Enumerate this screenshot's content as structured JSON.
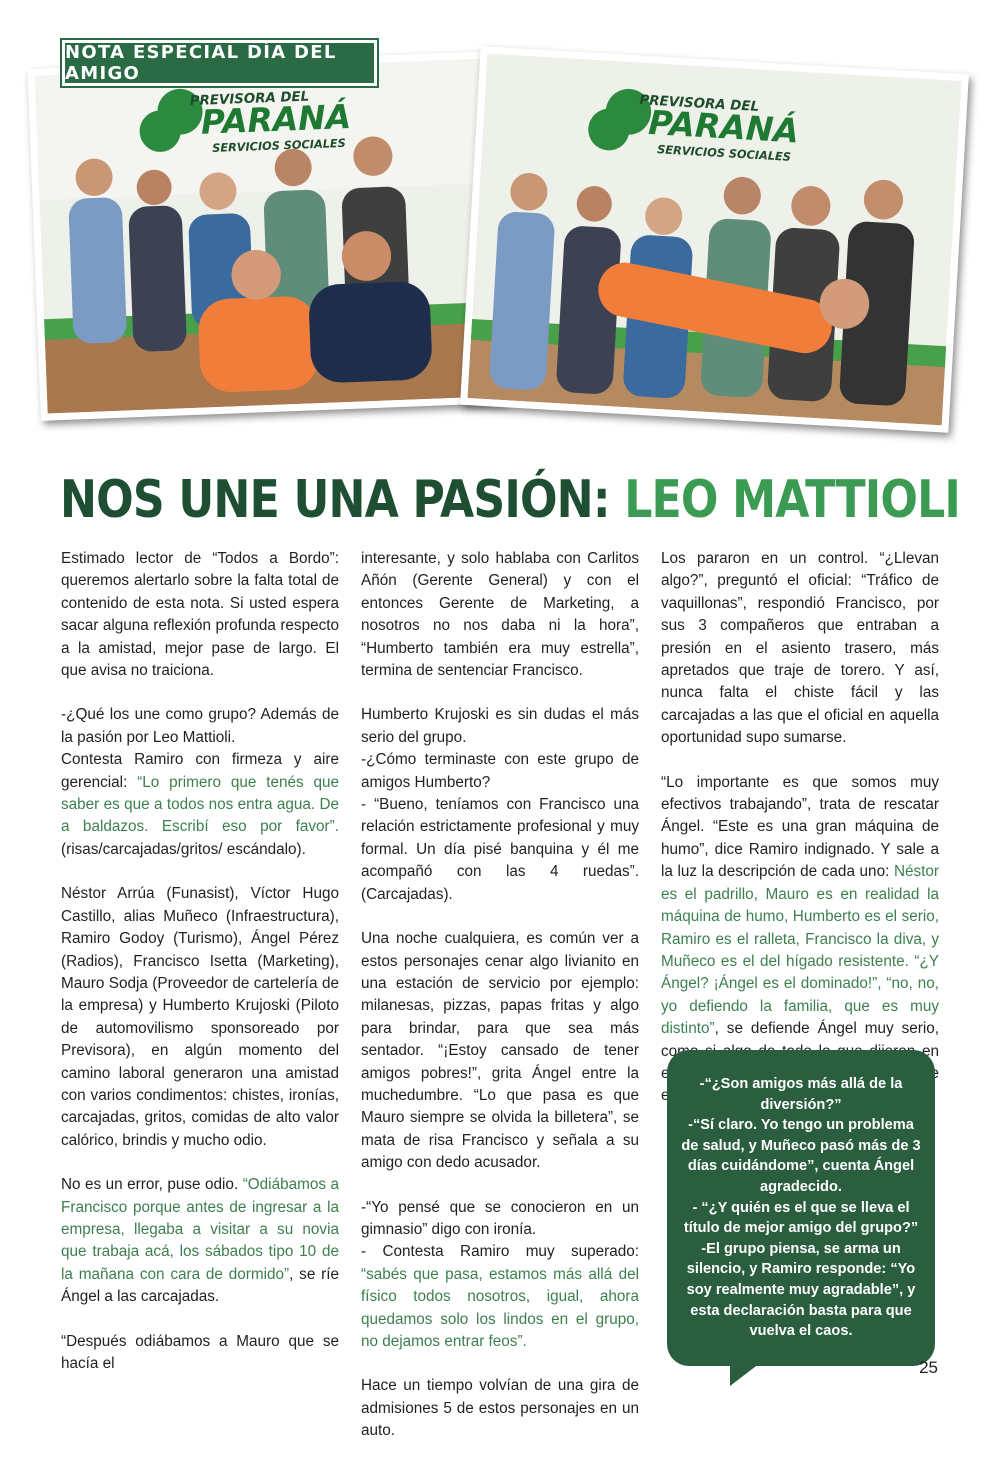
{
  "section_tag": "NOTA ESPECIAL DÍA DEL AMIGO",
  "photos": {
    "photo1": {
      "logo_line1": "PREVISORA DEL",
      "logo_line2": "PARANÁ",
      "logo_line3": "SERVICIOS SOCIALES"
    },
    "photo2": {
      "logo_line1": "PREVISORA DEL",
      "logo_line2": "PARANÁ",
      "logo_line3": "SERVICIOS SOCIALES"
    }
  },
  "headline": {
    "part1": "NOS UNE UNA PASIÓN: ",
    "part2": "LEO MATTIOLI"
  },
  "col1": {
    "p1": "Estimado lector de “Todos a Bordo”: queremos alertarlo sobre la falta total de contenido de esta nota. Si usted espera sacar alguna reflexión profunda respecto a la amistad, mejor pase de largo. El que avisa no traiciona.",
    "p2": "-¿Qué los une como grupo? Además de la pasión por Leo Mattioli.",
    "p3": "Contesta Ramiro con firmeza y aire gerencial:",
    "p3_quote": "“Lo primero que tenés que saber es que a todos nos entra agua. De a baldazos. Escribí eso por favor”.",
    "p3_tail": " (risas/carcajadas/gritos/ escándalo).",
    "p4": "Néstor Arrúa (Funasist), Víctor Hugo Castillo, alias Muñeco (Infraestructura), Ramiro Godoy (Turismo), Ángel Pérez (Radios), Francisco Isetta (Marketing), Mauro Sodja (Proveedor de cartelería de la empresa) y Humberto Krujoski (Piloto de automovilismo sponsoreado por Previsora), en algún momento del camino laboral generaron una amistad con varios condimentos: chistes, ironías, carcajadas, gritos, comidas de alto valor calórico, brindis y mucho odio.",
    "p5": "No es un error, puse odio. ",
    "p5_quote": "“Odiábamos a Francisco porque antes de ingresar a la empresa, llegaba a visitar a su novia que trabaja acá, los sábados tipo 10 de la mañana con cara de dormido”",
    "p5_tail": ", se ríe Ángel a las carcajadas.",
    "p6": "“Después odiábamos a Mauro que se hacía el"
  },
  "col2": {
    "p1": "interesante, y solo hablaba con Carlitos Añón (Gerente General) y con el entonces Gerente de Marketing, a nosotros no nos daba ni la hora”, “Humberto también era muy estrella”, termina de sentenciar Francisco.",
    "p2": "Humberto Krujoski es sin dudas el más serio del grupo.",
    "p3": "-¿Cómo terminaste con este grupo de amigos Humberto?",
    "p4": "- “Bueno, teníamos con Francisco una relación estrictamente profesional y muy formal. Un día pisé banquina y él me acompañó con las 4 ruedas”. (Carcajadas).",
    "p5": "Una noche cualquiera, es común ver a estos personajes cenar algo livianito en una estación de servicio por ejemplo: milanesas, pizzas, papas fritas y algo para brindar, para que sea más sentador.  “¡Estoy cansado de tener amigos pobres!”, grita Ángel entre la muchedumbre. “Lo que pasa es que Mauro siempre se olvida la billetera”, se mata de risa Francisco y señala a su amigo con dedo acusador.",
    "p6": "-“Yo pensé que se conocieron en un gimnasio” digo con ironía.",
    "p7": "- Contesta Ramiro muy superado: ",
    "p7_quote": "“sabés que pasa, estamos más allá del físico todos nosotros, igual, ahora quedamos solo los lindos en el grupo, no dejamos entrar feos”.",
    "p8": "Hace un tiempo volvían de una gira de admisiones 5 de estos personajes en un auto."
  },
  "col3": {
    "p1": "Los pararon en un control. “¿Llevan algo?”, preguntó el oficial: “Tráfico de vaquillonas”, respondió Francisco, por sus 3 compañeros que entraban a presión en el asiento trasero, más apretados que traje de torero. Y así, nunca falta el chiste fácil y las carcajadas a las que el oficial en aquella oportunidad supo sumarse.",
    "p2": "“Lo importante es que somos muy efectivos trabajando”, trata de rescatar Ángel. “Este es una gran máquina de humo”, dice Ramiro indignado. Y sale a la luz la descripción de cada uno: ",
    "p2_quote": "Néstor es el padrillo, Mauro es en realidad la máquina de humo, Humberto es el serio, Ramiro es el ralleta, Francisco la diva, y Muñeco es el del hígado resistente. “¿Y Ángel? ¡Ángel es el dominado!”, “no, no, yo defiendo la familia, que es muy distinto”",
    "p2_tail": ", se defiende Ángel muy serio, como si algo de todo lo que dijeron en esta nota fuera cierto o digno de tenerse en cuenta."
  },
  "bubble": {
    "q1": "-“¿Son amigos más allá de la diversión?”",
    "a1": "-“Sí claro. Yo tengo un problema de salud, y Muñeco pasó más de 3 días cuidándome”, cuenta Ángel agradecido.",
    "q2": "- “¿Y quién es el que se lleva el título de mejor amigo del grupo?”",
    "a2": "-El grupo piensa, se arma un silencio, y Ramiro responde: “Yo soy realmente muy agradable”, y esta declaración basta para que vuelva el caos."
  },
  "page_number": "25",
  "colors": {
    "dark_green": "#1f4f33",
    "green": "#3c9b53",
    "quote_green": "#3c7f4e",
    "bubble_green": "#2a5e3f"
  }
}
